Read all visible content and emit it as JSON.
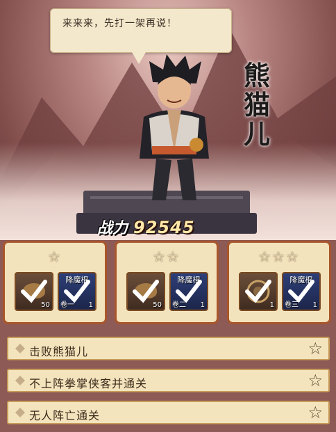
{
  "dialog": {
    "text": "来来来，先打一架再说！"
  },
  "boss": {
    "name": "熊猫儿",
    "power_label": "战力",
    "power_value": "92545"
  },
  "reward_tiers": [
    {
      "stars": "☆",
      "items": [
        {
          "icon": "gold-ingot-icon",
          "count": "50",
          "top_label": "",
          "bottom_label": ""
        },
        {
          "icon": "scroll-book-icon",
          "count": "1",
          "top_label": "降魔棍",
          "bottom_label": "卷一"
        }
      ]
    },
    {
      "stars": "☆☆",
      "items": [
        {
          "icon": "gold-ingot-icon",
          "count": "50",
          "top_label": "",
          "bottom_label": ""
        },
        {
          "icon": "scroll-book-icon",
          "count": "1",
          "top_label": "降魔棍",
          "bottom_label": "卷二"
        }
      ]
    },
    {
      "stars": "☆☆☆",
      "items": [
        {
          "icon": "compass-orb-icon",
          "count": "1",
          "top_label": "",
          "bottom_label": ""
        },
        {
          "icon": "scroll-book-icon",
          "count": "1",
          "top_label": "降魔棍",
          "bottom_label": "卷三"
        }
      ]
    }
  ],
  "conditions": [
    {
      "text": "击败熊猫儿",
      "star": "☆"
    },
    {
      "text": "不上阵拳掌侠客并通关",
      "star": "☆"
    },
    {
      "text": "无人阵亡通关",
      "star": "☆"
    }
  ],
  "colors": {
    "panel_border": "#a9562b",
    "panel_bg": "#f3e3bc",
    "check": "#ffffff"
  }
}
